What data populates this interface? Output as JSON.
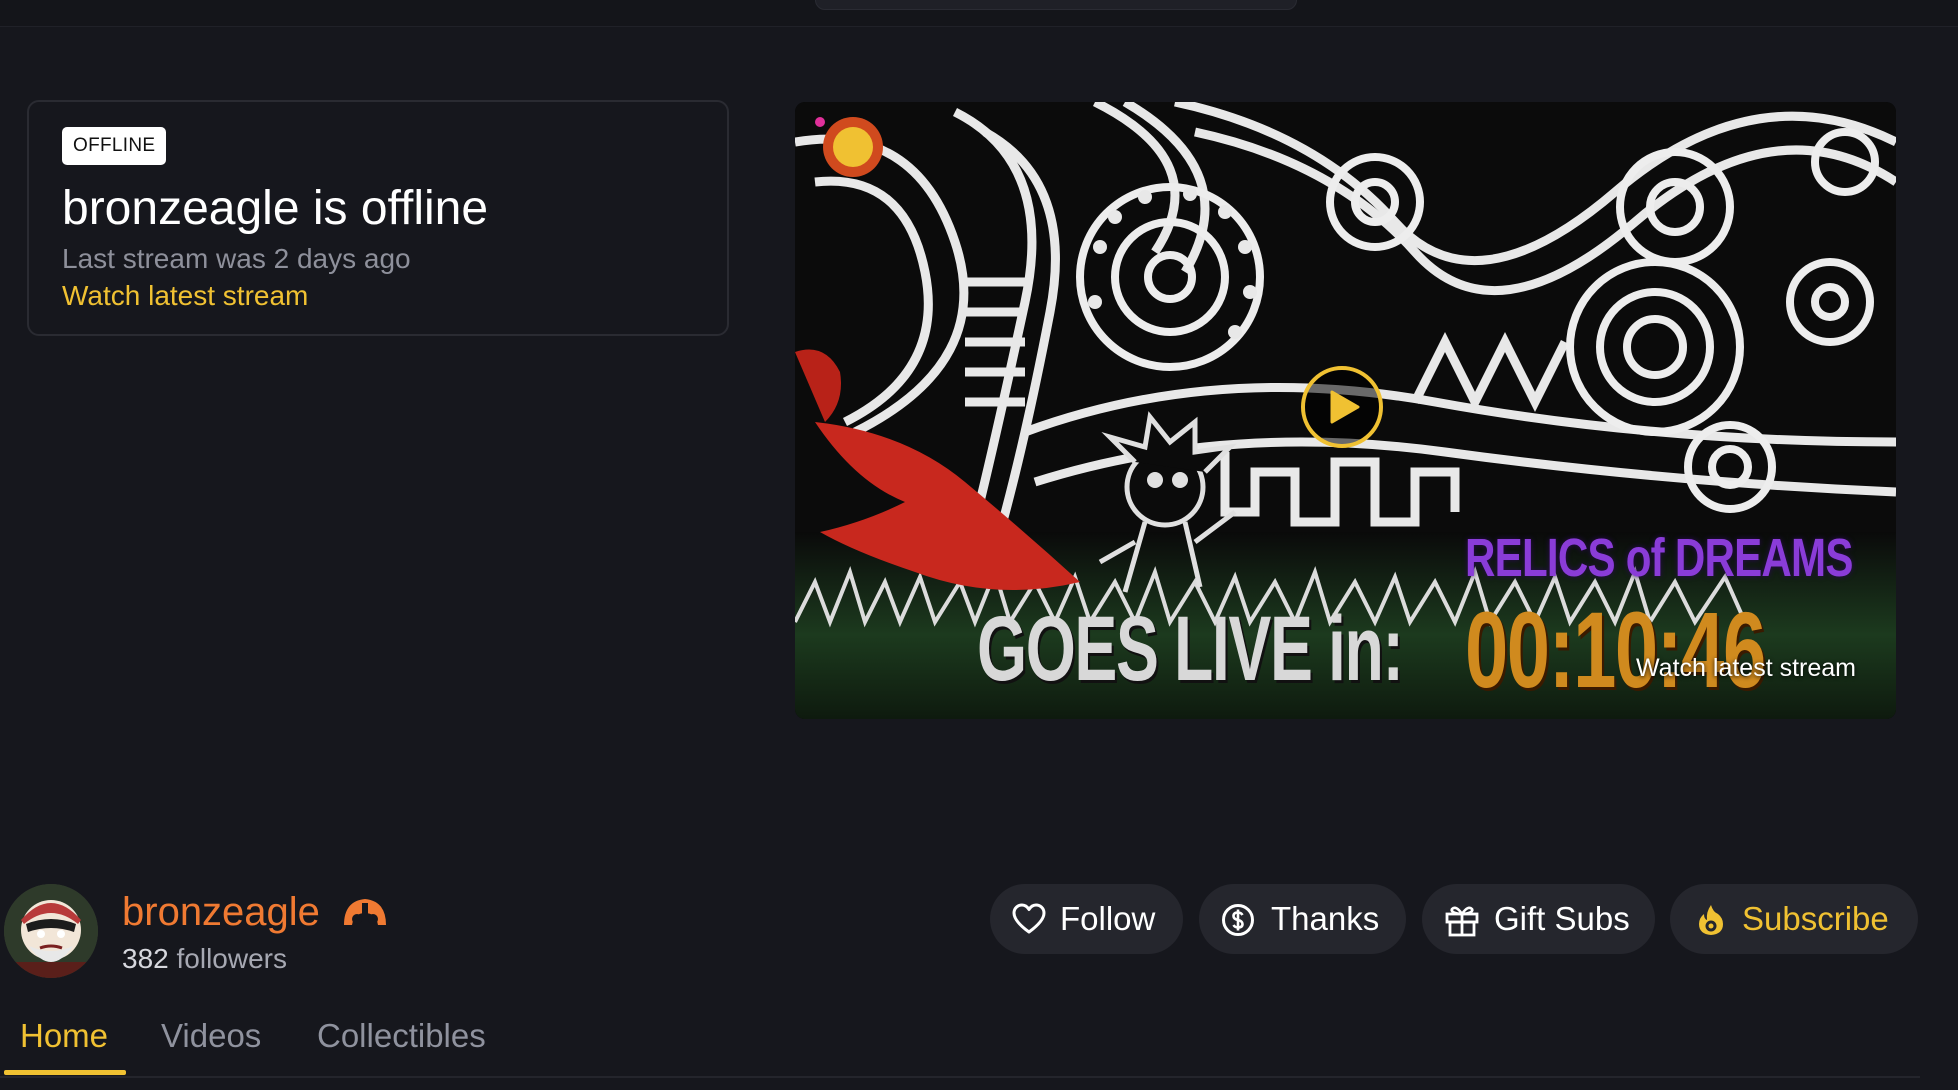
{
  "offline_card": {
    "badge": "OFFLINE",
    "title": "bronzeagle is offline",
    "subtitle": "Last stream was 2 days ago",
    "link": "Watch latest stream"
  },
  "video": {
    "watch_label": "Watch latest stream",
    "banner_line1": "RELICS of DREAMS",
    "banner_goes": "GOES LIVE in:",
    "banner_time": "00:10:46"
  },
  "channel": {
    "name": "bronzeagle",
    "followers_count": "382",
    "followers_label": "followers"
  },
  "actions": {
    "follow": "Follow",
    "thanks": "Thanks",
    "gift_subs": "Gift Subs",
    "subscribe": "Subscribe"
  },
  "tabs": [
    {
      "label": "Home",
      "active": true
    },
    {
      "label": "Videos",
      "active": false
    },
    {
      "label": "Collectibles",
      "active": false
    }
  ],
  "colors": {
    "background": "#16171d",
    "accent_yellow": "#f0c132",
    "channel_orange": "#f07a32",
    "muted_text": "#8e909b",
    "button_bg": "#25262d"
  },
  "icons": [
    "heart-icon",
    "dollar-coin-icon",
    "gift-icon",
    "flame-icon",
    "play-icon",
    "channel-badge-icon"
  ]
}
